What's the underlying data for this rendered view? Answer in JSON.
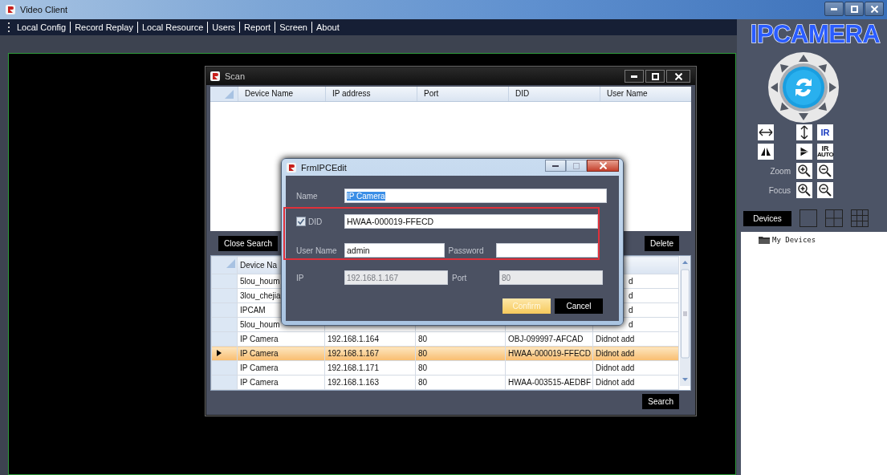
{
  "window": {
    "title": "Video Client"
  },
  "menu": [
    {
      "label": "Local Config"
    },
    {
      "label": "Record Replay"
    },
    {
      "label": "Local Resource"
    },
    {
      "label": "Users"
    },
    {
      "label": "Report"
    },
    {
      "label": "Screen"
    },
    {
      "label": "About"
    }
  ],
  "side_panel": {
    "logo": "IPCAMERA",
    "ptz_grid": [
      [
        {
          "kind": "pan"
        },
        {
          "kind": "tilt"
        },
        {
          "kind": "text",
          "label": "IR"
        }
      ],
      [
        {
          "kind": "mirror"
        },
        {
          "kind": "flip"
        },
        {
          "kind": "text",
          "label": "IR",
          "sublabel": "AUTO"
        }
      ],
      [
        {
          "kind": "label",
          "label": "Zoom"
        },
        {
          "kind": "plus"
        },
        {
          "kind": "minus"
        }
      ],
      [
        {
          "kind": "label",
          "label": "Focus"
        },
        {
          "kind": "plus"
        },
        {
          "kind": "minus"
        }
      ]
    ],
    "devices_tab": "Devices",
    "layouts": [
      {
        "kind": "single"
      },
      {
        "kind": "quad"
      },
      {
        "kind": "nine"
      }
    ],
    "tree": [
      {
        "label": "My Devices"
      }
    ]
  },
  "scan_window": {
    "title": "Scan",
    "results_table": {
      "columns": [
        "Device Name",
        "IP address",
        "Port",
        "DID",
        "User Name"
      ]
    },
    "close_search_button": "Close Search",
    "delete_button": "Delete",
    "search_button": "Search",
    "device_table": {
      "columns": [
        "Device Na"
      ],
      "rows": [
        {
          "kind": "partial",
          "selected": false,
          "device_name": "5lou_houm",
          "status": "d"
        },
        {
          "kind": "partial",
          "selected": false,
          "device_name": "3lou_chejia",
          "status": "d"
        },
        {
          "kind": "partial",
          "selected": false,
          "device_name": "IPCAM",
          "status": "d"
        },
        {
          "kind": "partial",
          "selected": false,
          "device_name": "5lou_houm",
          "status": "d"
        },
        {
          "kind": "full",
          "selected": false,
          "device_name": "IP Camera",
          "ip": "192.168.1.164",
          "port": "80",
          "did": "OBJ-099997-AFCAD",
          "status": "Didnot add"
        },
        {
          "kind": "full",
          "selected": true,
          "device_name": "IP Camera",
          "ip": "192.168.1.167",
          "port": "80",
          "did": "HWAA-000019-FFECD",
          "status": "Didnot add"
        },
        {
          "kind": "full",
          "selected": false,
          "device_name": "IP Camera",
          "ip": "192.168.1.171",
          "port": "80",
          "status": "Didnot add"
        },
        {
          "kind": "full",
          "selected": false,
          "device_name": "IP Camera",
          "ip": "192.168.1.163",
          "port": "80",
          "did": "HWAA-003515-AEDBF",
          "status": "Didnot add"
        }
      ]
    }
  },
  "edit_dialog": {
    "title": "FrmIPCEdit",
    "name": {
      "label": "Name",
      "value": "IP Camera",
      "value_selected": true
    },
    "credentials_highlighted": true,
    "did": {
      "label": "DID",
      "checked": true,
      "value": "HWAA-000019-FFECD"
    },
    "user_name": {
      "label": "User Name",
      "value": "admin"
    },
    "password": {
      "label": "Password"
    },
    "ip": {
      "label": "IP",
      "value": "192.168.1.167",
      "disabled": true
    },
    "port": {
      "label": "Port",
      "value": "80",
      "disabled": true
    },
    "buttons": [
      {
        "label": "Confirm",
        "disabled": true
      },
      {
        "label": "Cancel",
        "disabled": false
      }
    ]
  }
}
